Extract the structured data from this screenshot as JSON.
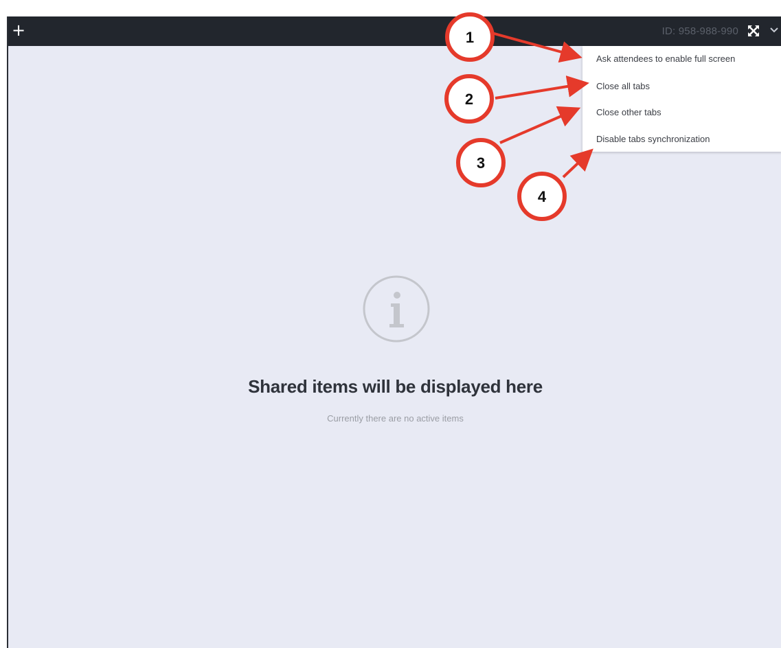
{
  "topbar": {
    "add_label": "+",
    "meeting_id": "ID: 958-988-990",
    "fullscreen_icon": "fullscreen-toggle-icon",
    "menu_caret_icon": "chevron-down-icon"
  },
  "menu": {
    "items": [
      {
        "label": "Ask attendees to enable full screen"
      },
      {
        "label": "Close all tabs"
      },
      {
        "label": "Close other tabs"
      },
      {
        "label": "Disable tabs synchronization"
      }
    ]
  },
  "empty_state": {
    "icon": "info-icon",
    "title": "Shared items will be displayed here",
    "subtitle": "Currently there are no active items"
  },
  "annotations": {
    "callouts": [
      {
        "number": "1"
      },
      {
        "number": "2"
      },
      {
        "number": "3"
      },
      {
        "number": "4"
      }
    ],
    "color": "#e53a2b"
  },
  "colors": {
    "topbar_bg": "#22262d",
    "content_bg": "#e8eaf4",
    "menu_bg": "#ffffff"
  }
}
